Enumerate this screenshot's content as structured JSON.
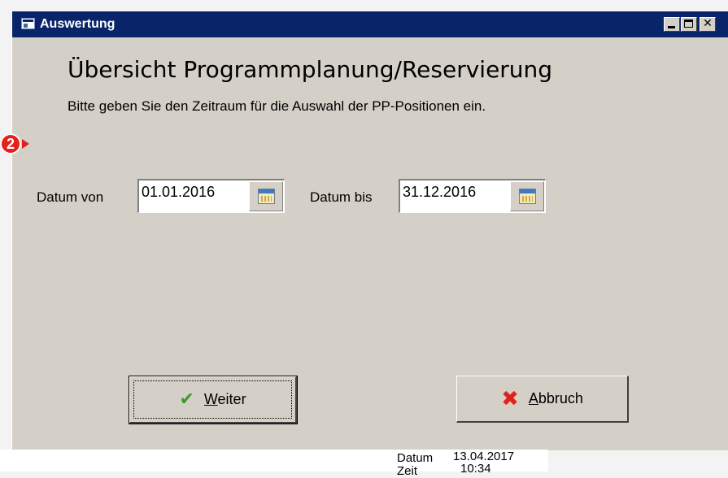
{
  "window": {
    "title": "Auswertung",
    "minimize_glyph": "",
    "close_glyph": "✕"
  },
  "dialog": {
    "heading": "Übersicht Programmplanung/Reservierung",
    "instruction": "Bitte geben Sie den Zeitraum für die Auswahl der PP-Positionen ein.",
    "date_from": {
      "label": "Datum von",
      "value": "01.01.2016"
    },
    "date_to": {
      "label": "Datum bis",
      "value": "31.12.2016"
    },
    "buttons": {
      "weiter": {
        "mnemonic": "W",
        "rest": "eiter",
        "icon": "✔"
      },
      "abbruch": {
        "mnemonic": "A",
        "rest": "bbruch",
        "icon": "✖"
      }
    }
  },
  "callout": {
    "number": "2",
    "color": "#e2211c"
  },
  "status": {
    "date_label": "Datum",
    "date_value": "13.04.2017",
    "time_label": "Zeit",
    "time_value": "10:34"
  },
  "colors": {
    "title_bar": "#0a246a",
    "dialog_bg": "#d4d0c8"
  }
}
